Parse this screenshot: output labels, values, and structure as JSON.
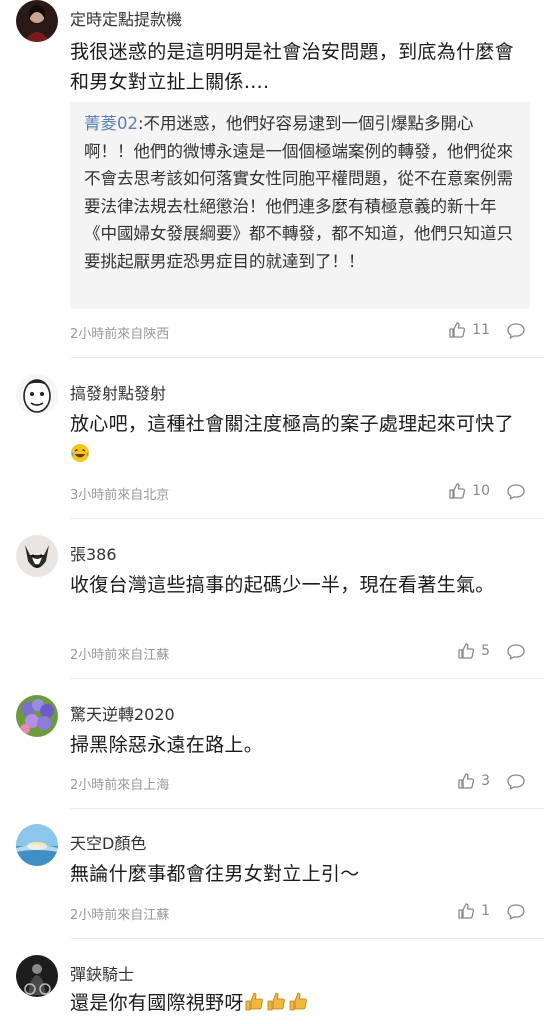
{
  "comments": [
    {
      "username": "定時定點提款機",
      "text": "我很迷惑的是這明明是社會治安問題，到底為什麼會和男女對立扯上關係….",
      "quote": {
        "author": "菁菱02",
        "text": ":不用迷惑，他們好容易逮到一個引爆點多開心啊！！他們的微博永遠是一個個極端案例的轉發，他們從來不會去思考該如何落實女性同胞平權問題，從不在意案例需要法律法規去杜絕懲治！他們連多麼有積極意義的新十年《中國婦女發展綱要》都不轉發，都不知道，他們只知道只要挑起厭男症恐男症目的就達到了！！"
      },
      "meta": "2小時前來自陝西",
      "likes": "11"
    },
    {
      "username": "搞發射點發射",
      "text": "放心吧，這種社會關注度極高的案子處理起來可快了",
      "emoji": "laughing-tears",
      "meta": "3小時前來自北京",
      "likes": "10"
    },
    {
      "username": "張386",
      "text": "收復台灣這些搞事的起碼少一半，現在看著生氣。",
      "meta": "2小時前來自江蘇",
      "likes": "5"
    },
    {
      "username": "驚天逆轉2020",
      "text": "掃黑除惡永遠在路上。",
      "meta": "2小時前來自上海",
      "likes": "3"
    },
    {
      "username": "天空D顏色",
      "text": "無論什麼事都會往男女對立上引～",
      "meta": "2小時前來自江蘇",
      "likes": "1"
    },
    {
      "username": "彈鋏騎士",
      "text": "還是你有國際視野呀",
      "emoji": "thumbs-up x3",
      "meta": "",
      "likes": ""
    }
  ],
  "colors": {
    "quote_author": "#5a7fb5",
    "meta": "#999999",
    "quote_bg": "#f4f4f4"
  }
}
